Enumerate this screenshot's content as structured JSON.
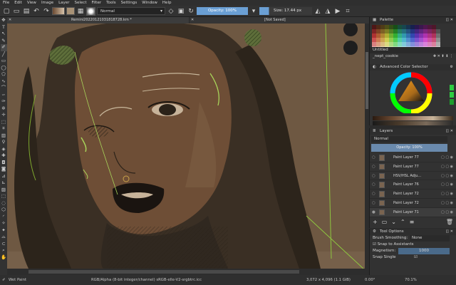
{
  "menu": [
    "File",
    "Edit",
    "View",
    "Image",
    "Layer",
    "Select",
    "Filter",
    "Tools",
    "Settings",
    "Window",
    "Help"
  ],
  "toolbar": {
    "blend_mode": "Normal",
    "opacity": "Opacity: 100%",
    "size": "Size: 17.44 px"
  },
  "tabs": [
    "Remini20220121031818728.krn *",
    "[Not Saved]"
  ],
  "docker_palette": {
    "title": "Palette",
    "palette_name": "Untitled",
    "brush_label": "_nept_cookie"
  },
  "docker_color": {
    "title": "Advanced Color Selector"
  },
  "docker_layers": {
    "title": "Layers",
    "blend": "Normal",
    "opacity": "Opacity: 100%",
    "layers": [
      {
        "name": "Paint Layer 77"
      },
      {
        "name": "Paint Layer 77"
      },
      {
        "name": "HSV/HSL Adju..."
      },
      {
        "name": "Paint Layer 76"
      },
      {
        "name": "Paint Layer 72"
      },
      {
        "name": "Paint Layer 72"
      },
      {
        "name": "Paint Layer 71"
      }
    ]
  },
  "docker_tool_options": {
    "title": "Tool Options",
    "brush_smoothing_label": "Brush Smoothing:",
    "brush_smoothing_value": "None",
    "snap_assistants": "Snap to Assistants",
    "magnetism_label": "Magnetism:",
    "magnetism_value": "1000",
    "snap_single": "Snap Single"
  },
  "status": {
    "brush": "Wet Paint",
    "color_info": "RGB/Alpha (8-bit integer/channel) sRGB-elle-V2-srgbtrc.icc",
    "dimensions": "3,072 x 4,096 (1.1 GiB)",
    "rotation": "0.00°",
    "zoom": "70.1%"
  },
  "colors": {
    "accent": "#6a9fd4",
    "bg": "#2b2b2b",
    "panel": "#323232",
    "canvas_bg": "#6e5842"
  }
}
